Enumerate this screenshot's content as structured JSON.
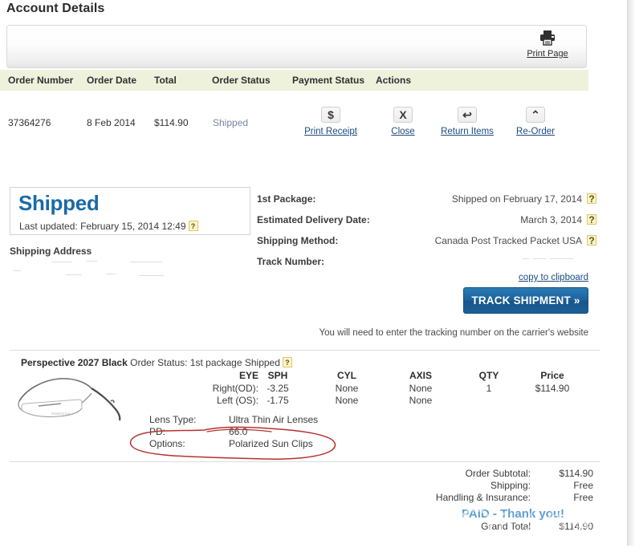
{
  "page": {
    "title": "Account Details"
  },
  "toolbar": {
    "print_page_label": "Print Page",
    "print_page_icon": "printer-icon"
  },
  "orders_table": {
    "columns": [
      "Order Number",
      "Order Date",
      "Total",
      "Order Status",
      "Payment Status",
      "Actions"
    ],
    "row": {
      "order_number": "37364276",
      "order_date": "8 Feb 2014",
      "total": "$114.90",
      "order_status": "Shipped",
      "payment_status": ""
    },
    "actions": [
      {
        "label": "Print Receipt",
        "glyph": "$",
        "icon": "dollar-icon"
      },
      {
        "label": "Close",
        "glyph": "X",
        "icon": "close-x-icon"
      },
      {
        "label": "Return Items",
        "glyph": "↩",
        "icon": "return-arrow-icon"
      },
      {
        "label": "Re-Order",
        "glyph": "⌃",
        "icon": "reorder-caret-icon"
      }
    ]
  },
  "status_panel": {
    "status": "Shipped",
    "last_updated_label": "Last updated:",
    "last_updated_value": "February 15, 2014 12:49",
    "help_glyph": "?",
    "shipping_address_label": "Shipping Address",
    "shipping_address_value": ""
  },
  "shipping_details": {
    "rows": [
      {
        "label": "1st Package:",
        "value": "Shipped on February 17, 2014",
        "help": "?"
      },
      {
        "label": "Estimated Delivery Date:",
        "value": "March 3, 2014",
        "help": "?"
      },
      {
        "label": "Shipping Method:",
        "value": "Canada Post Tracked Packet USA",
        "help": "?"
      },
      {
        "label": "Track Number:",
        "value": "",
        "help": ""
      }
    ],
    "copy_to_clipboard": "copy to clipboard",
    "track_button": "TRACK SHIPMENT  »",
    "carrier_note": "You will need to enter the tracking number on the carrier's website"
  },
  "product": {
    "name": "Perspective 2027 Black",
    "status_text": "Order Status: 1st package Shipped",
    "help_glyph": "?",
    "thumbnail_icon": "eyeglasses-thumbnail",
    "rx_headers": {
      "eye": "EYE",
      "sph": "SPH",
      "cyl": "CYL",
      "axis": "AXIS",
      "qty": "QTY",
      "price": "Price"
    },
    "rx_rows": [
      {
        "eye": "Right(OD):",
        "sph": "-3.25",
        "cyl": "None",
        "axis": "None",
        "qty": "1",
        "price": "$114.90"
      },
      {
        "eye": "Left (OS):",
        "sph": "-1.75",
        "cyl": "None",
        "axis": "None",
        "qty": "",
        "price": ""
      }
    ],
    "options": [
      {
        "label": "Lens Type:",
        "value": "Ultra Thin Air Lenses"
      },
      {
        "label": "PD:",
        "value": "66.0"
      },
      {
        "label": "Options:",
        "value": "Polarized Sun Clips"
      }
    ]
  },
  "totals": {
    "rows": [
      {
        "label": "Order Subtotal:",
        "value": "$114.90"
      },
      {
        "label": "Shipping:",
        "value": "Free"
      },
      {
        "label": "Handling & Insurance:",
        "value": "Free"
      },
      {
        "label": "Grand Total",
        "value": "$114.90"
      }
    ],
    "paid_message": "PAID - Thank you!"
  },
  "colors": {
    "accent_blue": "#1a6aa8",
    "link_blue": "#1b4b80",
    "table_header_green": "#eef2dd",
    "status_shipped": "#7486a0",
    "annotation_red": "#b5322e",
    "paid_blue": "#5e9fd4"
  },
  "annotation": {
    "type": "hand-drawn-red-ellipse",
    "target": "Options: Polarized Sun Clips"
  }
}
